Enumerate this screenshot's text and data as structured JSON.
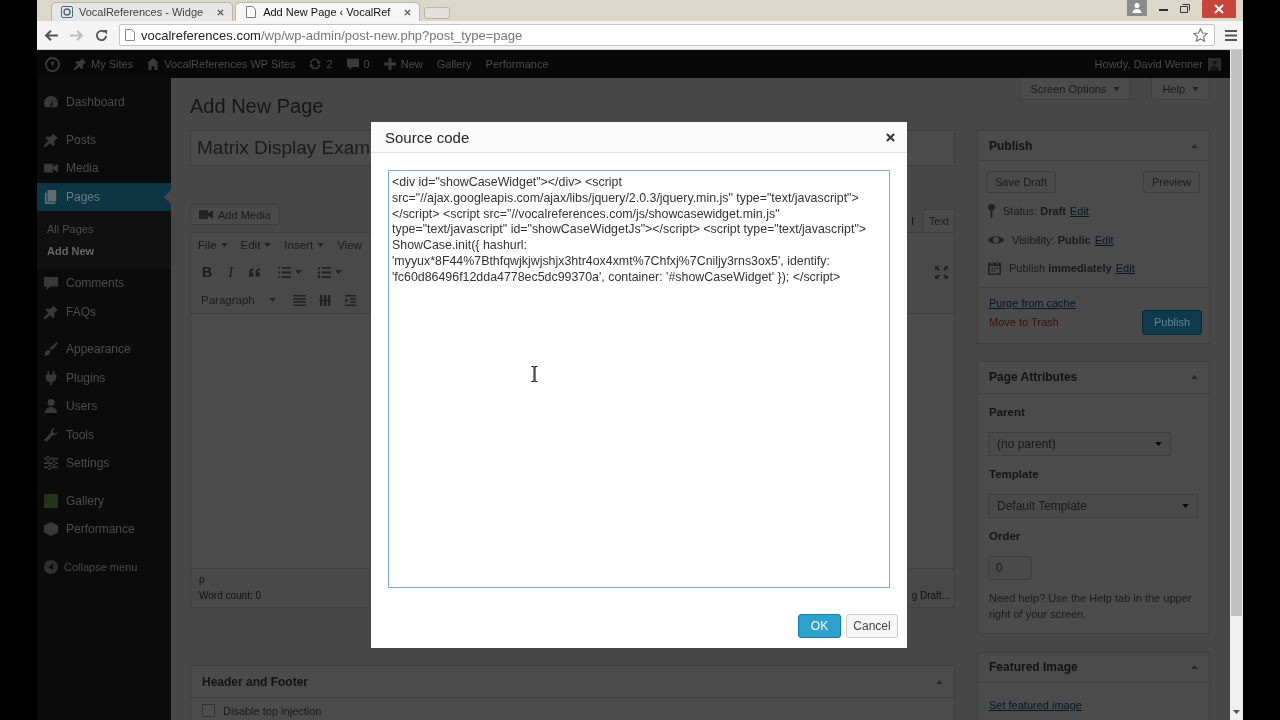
{
  "browser": {
    "tabs": [
      {
        "kind": "site",
        "title": "VocalReferences - Widge",
        "selected": false
      },
      {
        "kind": "page",
        "title": "Add New Page ‹ VocalRef",
        "selected": true
      }
    ],
    "url_host": "vocalreferences.com",
    "url_path": "/wp/wp-admin/post-new.php?post_type=page"
  },
  "admin_bar": {
    "items": [
      {
        "kind": "logo"
      },
      {
        "kind": "sites",
        "label": "My Sites"
      },
      {
        "kind": "home",
        "label": "VocalReferences WP Sites"
      },
      {
        "kind": "updates",
        "label": "2"
      },
      {
        "kind": "comments",
        "label": "0"
      },
      {
        "kind": "new",
        "label": "New"
      },
      {
        "kind": "text",
        "label": "Gallery"
      },
      {
        "kind": "text",
        "label": "Performance"
      }
    ],
    "account": "Howdy, David Wenner"
  },
  "sidebar": {
    "groups": [
      [
        {
          "kind": "dashboard",
          "label": "Dashboard",
          "selected": false
        }
      ],
      [
        {
          "kind": "pin",
          "label": "Posts",
          "selected": false
        },
        {
          "kind": "media",
          "label": "Media",
          "selected": false
        },
        {
          "kind": "pages",
          "label": "Pages",
          "selected": true,
          "children": [
            {
              "label": "All Pages",
              "selected": false
            },
            {
              "label": "Add New",
              "selected": true
            }
          ]
        },
        {
          "kind": "comments",
          "label": "Comments",
          "selected": false
        },
        {
          "kind": "pin",
          "label": "FAQs",
          "selected": false
        }
      ],
      [
        {
          "kind": "appearance",
          "label": "Appearance",
          "selected": false
        },
        {
          "kind": "plugins",
          "label": "Plugins",
          "selected": false
        },
        {
          "kind": "users",
          "label": "Users",
          "selected": false
        },
        {
          "kind": "tools",
          "label": "Tools",
          "selected": false
        },
        {
          "kind": "settings",
          "label": "Settings",
          "selected": false
        }
      ],
      [
        {
          "kind": "gallery",
          "label": "Gallery",
          "selected": false
        },
        {
          "kind": "performance",
          "label": "Performance",
          "selected": false
        }
      ]
    ],
    "collapse": "Collapse menu"
  },
  "header": {
    "title": "Add New Page",
    "screen_options": "Screen Options",
    "help": "Help"
  },
  "editor": {
    "post_title": "Matrix Display Exam",
    "add_media": "Add Media",
    "mode_tabs": [
      {
        "label": "l",
        "selected": true
      },
      {
        "label": "Text",
        "selected": false
      }
    ],
    "menus": [
      {
        "label": "File",
        "dropdown": true
      },
      {
        "label": "Edit",
        "dropdown": true
      },
      {
        "label": "Insert",
        "dropdown": true
      },
      {
        "label": "View",
        "dropdown": false
      }
    ],
    "toolbar_1": [
      {
        "kind": "bold",
        "label": "B"
      },
      {
        "kind": "italic",
        "label": "I"
      },
      {
        "kind": "quote"
      },
      {
        "kind": "bullets"
      },
      {
        "kind": "numbers"
      }
    ],
    "format": "Paragraph",
    "toolbar_2": [
      {
        "kind": "lines"
      },
      {
        "kind": "strike"
      },
      {
        "kind": "indent"
      }
    ],
    "path": "p",
    "word_count": "Word count: 0",
    "autosave": "g Draft..."
  },
  "header_footer": {
    "title": "Header and Footer",
    "options": [
      {
        "label": "Disable top injection",
        "checked": false
      }
    ]
  },
  "publish": {
    "title": "Publish",
    "save_draft": "Save Draft",
    "preview": "Preview",
    "meta": [
      {
        "kind": "status",
        "text": "Status: **Draft**",
        "link": "Edit"
      },
      {
        "kind": "visibility",
        "text": "Visibility: **Public**",
        "link": "Edit"
      },
      {
        "kind": "schedule",
        "text": "Publish **immediately**",
        "link": "Edit"
      }
    ],
    "purge": "Purge from cache",
    "trash": "Move to Trash",
    "button": "Publish"
  },
  "page_attributes": {
    "title": "Page Attributes",
    "fields": [
      {
        "kind": "select",
        "label": "Parent",
        "value": "(no parent)"
      },
      {
        "kind": "select",
        "label": "Template",
        "value": "Default Template"
      },
      {
        "kind": "input",
        "label": "Order",
        "value": "0"
      }
    ],
    "help": "Need help? Use the Help tab in the upper right of your screen."
  },
  "featured_image": {
    "title": "Featured Image",
    "link": "Set featured image"
  },
  "modal": {
    "title": "Source code",
    "code": "<div id=\"showCaseWidget\"></div> <script src=\"//ajax.googleapis.com/ajax/libs/jquery/2.0.3/jquery.min.js\" type=\"text/javascript\"> </script> <script src=\"//vocalreferences.com/js/showcasewidget.min.js\" type=\"text/javascript\" id=\"showCaseWidgetJs\"></script> <script type=\"text/javascript\"> ShowCase.init({ hashurl: 'myyux*8F44%7Bthfqwjkjwjshjx3htr4ox4xmt%7Chfxj%7Cniljy3rns3ox5', identify: 'fc60d86496f12dda4778ec5dc99370a', container: '#showCaseWidget' }); </script>",
    "ok": "OK",
    "cancel": "Cancel"
  }
}
